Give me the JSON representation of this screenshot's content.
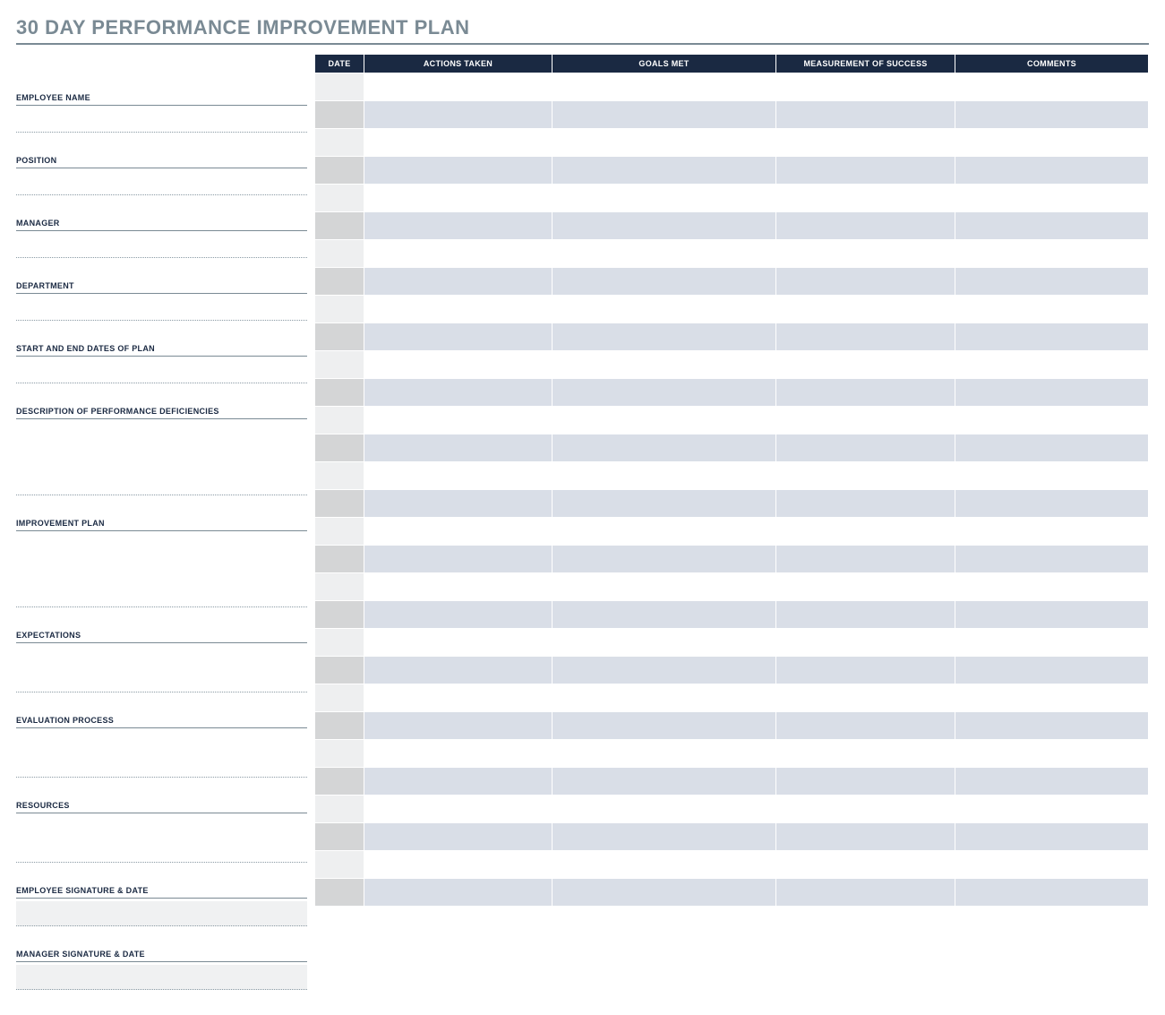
{
  "title": "30 DAY PERFORMANCE IMPROVEMENT PLAN",
  "fields": {
    "employee_name": {
      "label": "EMPLOYEE NAME",
      "value": ""
    },
    "position": {
      "label": "POSITION",
      "value": ""
    },
    "manager": {
      "label": "MANAGER",
      "value": ""
    },
    "department": {
      "label": "DEPARTMENT",
      "value": ""
    },
    "start_end_dates": {
      "label": "START AND END DATES OF PLAN",
      "value": ""
    },
    "deficiencies": {
      "label": "DESCRIPTION OF PERFORMANCE DEFICIENCIES",
      "value": ""
    },
    "improvement_plan": {
      "label": "IMPROVEMENT PLAN",
      "value": ""
    },
    "expectations": {
      "label": "EXPECTATIONS",
      "value": ""
    },
    "evaluation_process": {
      "label": "EVALUATION PROCESS",
      "value": ""
    },
    "resources": {
      "label": "RESOURCES",
      "value": ""
    },
    "employee_signature": {
      "label": "EMPLOYEE SIGNATURE & DATE",
      "value": ""
    },
    "manager_signature": {
      "label": "MANAGER SIGNATURE & DATE",
      "value": ""
    }
  },
  "table": {
    "headers": {
      "date": "DATE",
      "actions": "ACTIONS TAKEN",
      "goals": "GOALS MET",
      "measure": "MEASUREMENT OF SUCCESS",
      "comments": "COMMENTS"
    },
    "rows": [
      {
        "date": "",
        "actions": "",
        "goals": "",
        "measure": "",
        "comments": ""
      },
      {
        "date": "",
        "actions": "",
        "goals": "",
        "measure": "",
        "comments": ""
      },
      {
        "date": "",
        "actions": "",
        "goals": "",
        "measure": "",
        "comments": ""
      },
      {
        "date": "",
        "actions": "",
        "goals": "",
        "measure": "",
        "comments": ""
      },
      {
        "date": "",
        "actions": "",
        "goals": "",
        "measure": "",
        "comments": ""
      },
      {
        "date": "",
        "actions": "",
        "goals": "",
        "measure": "",
        "comments": ""
      },
      {
        "date": "",
        "actions": "",
        "goals": "",
        "measure": "",
        "comments": ""
      },
      {
        "date": "",
        "actions": "",
        "goals": "",
        "measure": "",
        "comments": ""
      },
      {
        "date": "",
        "actions": "",
        "goals": "",
        "measure": "",
        "comments": ""
      },
      {
        "date": "",
        "actions": "",
        "goals": "",
        "measure": "",
        "comments": ""
      },
      {
        "date": "",
        "actions": "",
        "goals": "",
        "measure": "",
        "comments": ""
      },
      {
        "date": "",
        "actions": "",
        "goals": "",
        "measure": "",
        "comments": ""
      },
      {
        "date": "",
        "actions": "",
        "goals": "",
        "measure": "",
        "comments": ""
      },
      {
        "date": "",
        "actions": "",
        "goals": "",
        "measure": "",
        "comments": ""
      },
      {
        "date": "",
        "actions": "",
        "goals": "",
        "measure": "",
        "comments": ""
      },
      {
        "date": "",
        "actions": "",
        "goals": "",
        "measure": "",
        "comments": ""
      },
      {
        "date": "",
        "actions": "",
        "goals": "",
        "measure": "",
        "comments": ""
      },
      {
        "date": "",
        "actions": "",
        "goals": "",
        "measure": "",
        "comments": ""
      },
      {
        "date": "",
        "actions": "",
        "goals": "",
        "measure": "",
        "comments": ""
      },
      {
        "date": "",
        "actions": "",
        "goals": "",
        "measure": "",
        "comments": ""
      },
      {
        "date": "",
        "actions": "",
        "goals": "",
        "measure": "",
        "comments": ""
      },
      {
        "date": "",
        "actions": "",
        "goals": "",
        "measure": "",
        "comments": ""
      },
      {
        "date": "",
        "actions": "",
        "goals": "",
        "measure": "",
        "comments": ""
      },
      {
        "date": "",
        "actions": "",
        "goals": "",
        "measure": "",
        "comments": ""
      },
      {
        "date": "",
        "actions": "",
        "goals": "",
        "measure": "",
        "comments": ""
      },
      {
        "date": "",
        "actions": "",
        "goals": "",
        "measure": "",
        "comments": ""
      },
      {
        "date": "",
        "actions": "",
        "goals": "",
        "measure": "",
        "comments": ""
      },
      {
        "date": "",
        "actions": "",
        "goals": "",
        "measure": "",
        "comments": ""
      },
      {
        "date": "",
        "actions": "",
        "goals": "",
        "measure": "",
        "comments": ""
      },
      {
        "date": "",
        "actions": "",
        "goals": "",
        "measure": "",
        "comments": ""
      }
    ]
  }
}
